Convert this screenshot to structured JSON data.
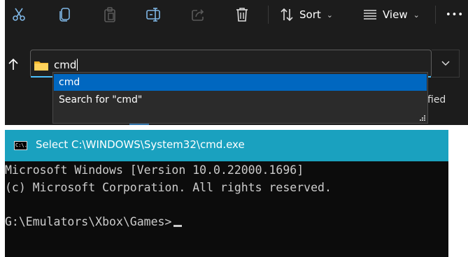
{
  "toolbar": {
    "cut_icon": "scissors-icon",
    "copy_icon": "copy-icon",
    "paste_icon": "clipboard-icon",
    "rename_icon": "rename-icon",
    "share_icon": "share-icon",
    "delete_icon": "trash-icon",
    "sort_label": "Sort",
    "view_label": "View",
    "more_label": "•••"
  },
  "address_bar": {
    "value": "cmd",
    "folder_icon": "folder-icon",
    "up_icon": "up-arrow-icon"
  },
  "autocomplete": {
    "items": [
      {
        "label": "cmd",
        "selected": true
      },
      {
        "label": "Search for \"cmd\"",
        "selected": false
      }
    ]
  },
  "background_column_label": "fied",
  "console": {
    "title": "Select C:\\WINDOWS\\System32\\cmd.exe",
    "icon_label": "C:\\.",
    "lines": [
      "Microsoft Windows [Version 10.0.22000.1696]",
      "(c) Microsoft Corporation. All rights reserved.",
      "",
      "G:\\Emulators\\Xbox\\Games>"
    ]
  },
  "colors": {
    "explorer_bg": "#1c1c1c",
    "selection": "#0067c0",
    "accent_underline": "#4cc2ff",
    "console_title_bg": "#1aa1bf",
    "console_bg": "#0c0c0c",
    "console_text": "#cccccc"
  }
}
